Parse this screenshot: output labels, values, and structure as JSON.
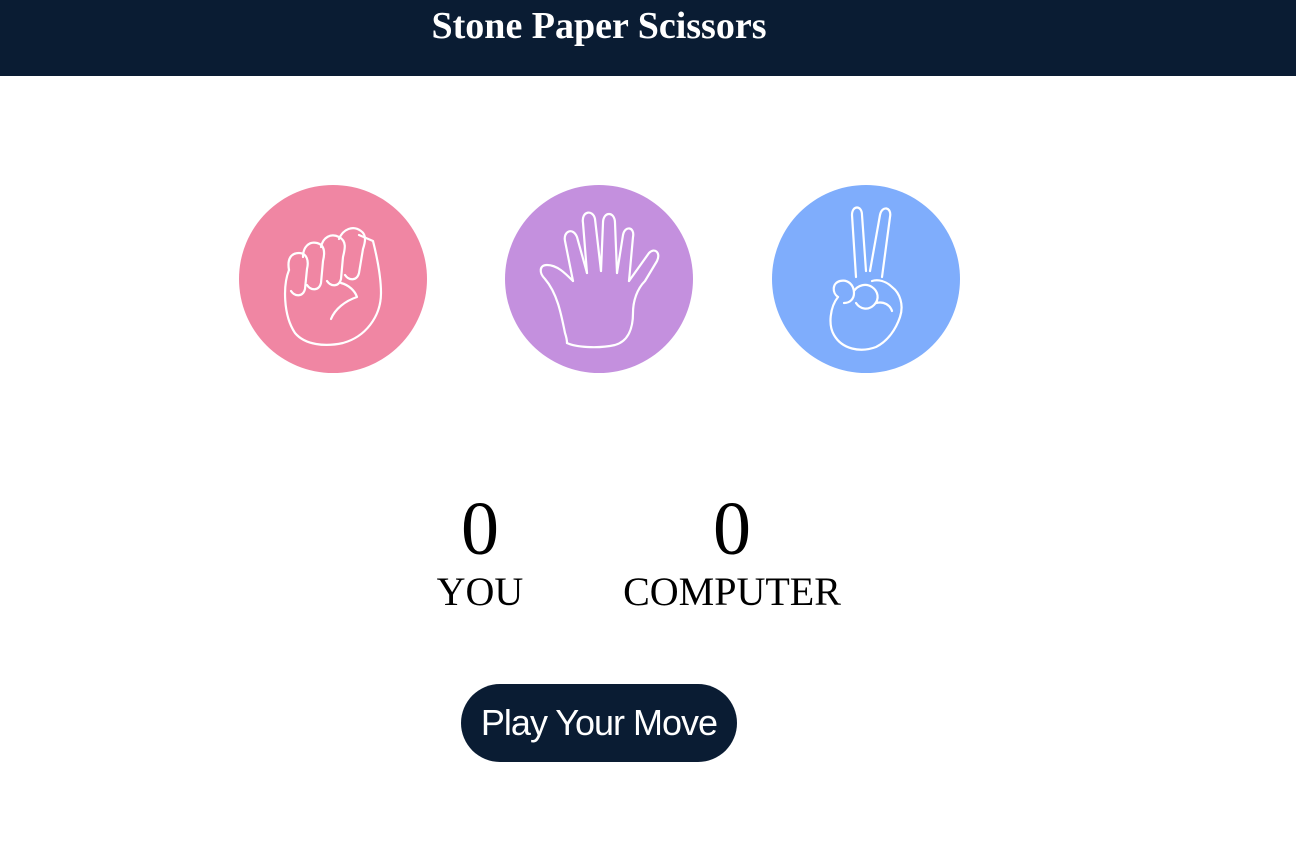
{
  "header": {
    "title": "Stone Paper Scissors",
    "background_color": "#0a1c33"
  },
  "choices": [
    {
      "id": "stone",
      "icon": "fist-icon",
      "color": "#f086a3"
    },
    {
      "id": "paper",
      "icon": "open-hand-icon",
      "color": "#c490de"
    },
    {
      "id": "scissors",
      "icon": "peace-hand-icon",
      "color": "#7fadfc"
    }
  ],
  "scoreboard": {
    "user": {
      "score": "0",
      "label": "YOU"
    },
    "computer": {
      "score": "0",
      "label": "COMPUTER"
    }
  },
  "play_button": {
    "label": "Play Your Move",
    "color": "#0a1c33"
  }
}
